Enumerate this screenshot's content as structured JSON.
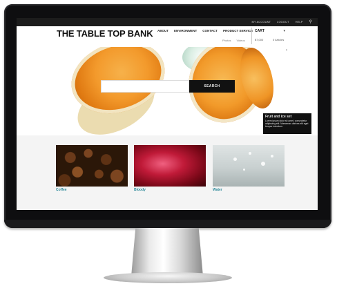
{
  "top_links": [
    "MY ACCOUNT",
    "LOGOUT",
    "HELP"
  ],
  "search_icon": "search-icon",
  "site": {
    "logo": "THE TABLE TOP BANK",
    "nav": [
      "ABOUT",
      "ENVIRONMENT",
      "CONTACT",
      "PRODUCT SERVICE"
    ],
    "sub_nav": [
      "Photos",
      "Videos"
    ]
  },
  "cart": {
    "title": "CART",
    "value": "$7,000",
    "count": "0 Articles",
    "dropdown_icon": "chevron-down-icon"
  },
  "hero": {
    "search_placeholder": "",
    "search_button": "SEARCH",
    "caption_title": "Fruit and ice set",
    "caption_body": "Lorem ipsum dolor sit amet, consectetur adipiscing elit. Maecenas ultrices elit eget tempor interdum."
  },
  "thumbnails": [
    {
      "label": "Coffee"
    },
    {
      "label": "Bloody"
    },
    {
      "label": "Water"
    }
  ],
  "colors": {
    "topbar": "#1c1c1c",
    "accent_link": "#2e8a9a",
    "button": "#111111"
  }
}
